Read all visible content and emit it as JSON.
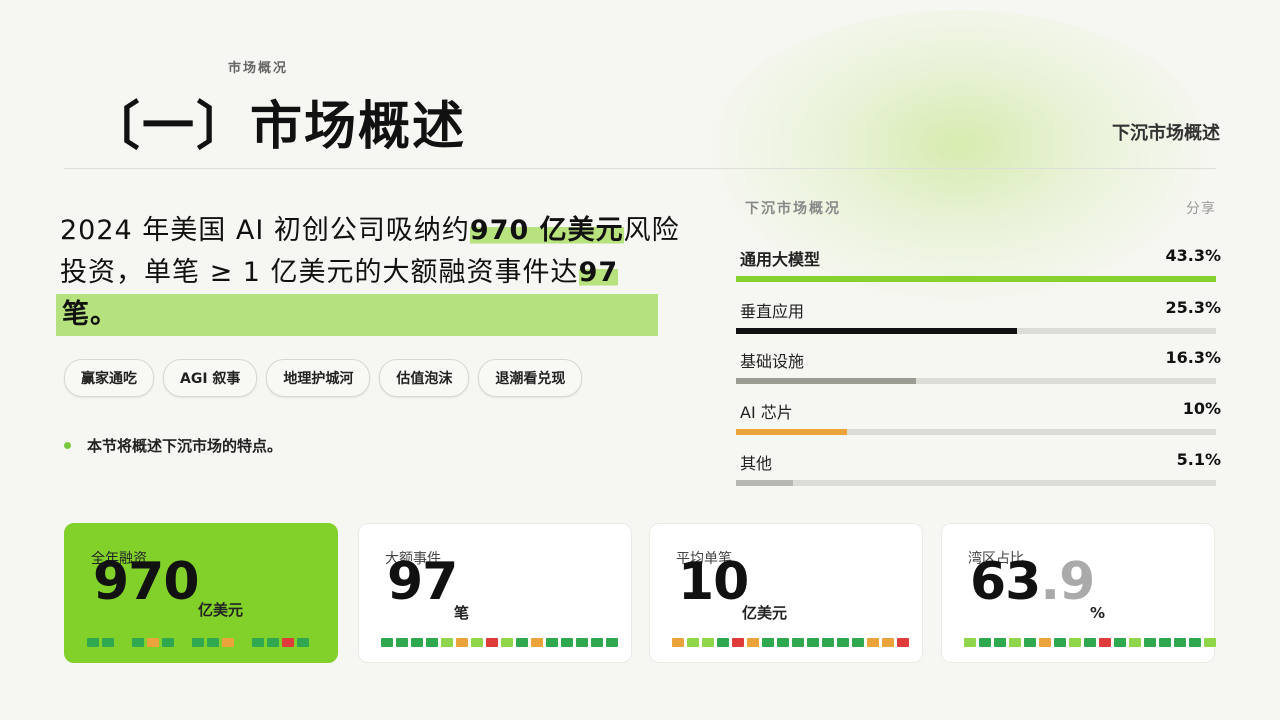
{
  "header": {
    "eyebrow": "市场概况",
    "title": "〔一〕市场概述",
    "section_label": "下沉市场概述"
  },
  "headline": {
    "part1": "2024 年美国 AI 初创公司吸纳约",
    "highlight1": "970 亿美元",
    "part2": "风险投资，单笔 ≥ 1 亿美元的大额融资事件达",
    "highlight2": "97",
    "highlight3": "笔。"
  },
  "tags": [
    "赢家通吃",
    "AGI 叙事",
    "地理护城河",
    "估值泡沫",
    "退潮看兑现"
  ],
  "note": "本节将概述下沉市场的特点。",
  "breakdown": {
    "title": "下沉市场概况",
    "share_label": "分享",
    "items": [
      {
        "label": "通用大模型",
        "value": "43.3%",
        "fraction": 1.0,
        "color": "#86d12d",
        "bold": true
      },
      {
        "label": "垂直应用",
        "value": "25.3%",
        "fraction": 0.585,
        "color": "#111111",
        "bold": false
      },
      {
        "label": "基础设施",
        "value": "16.3%",
        "fraction": 0.376,
        "color": "#9b9c93",
        "bold": false
      },
      {
        "label": "AI 芯片",
        "value": "10%",
        "fraction": 0.231,
        "color": "#eaa43a",
        "bold": false
      },
      {
        "label": "其他",
        "value": "5.1%",
        "fraction": 0.118,
        "color": "#b8b8b2",
        "bold": false
      }
    ]
  },
  "cards": [
    {
      "label": "全年融资",
      "number": "970",
      "number_dim": "",
      "unit": "亿美元",
      "highlight": true
    },
    {
      "label": "大额事件",
      "number": "97",
      "number_dim": "",
      "unit": "笔",
      "highlight": false
    },
    {
      "label": "平均单笔",
      "number": "10",
      "number_dim": "",
      "unit": "亿美元",
      "highlight": false
    },
    {
      "label": "湾区占比",
      "number": "63",
      "number_dim": ".9",
      "unit": "%",
      "highlight": false
    }
  ],
  "colors": {
    "accent_green": "#82d12b",
    "highlight_green": "#b7e27d",
    "strip_green_dark": "#2fa84f",
    "strip_green_light": "#8fd64a",
    "strip_orange": "#eba33b",
    "strip_red": "#e03b3b"
  }
}
